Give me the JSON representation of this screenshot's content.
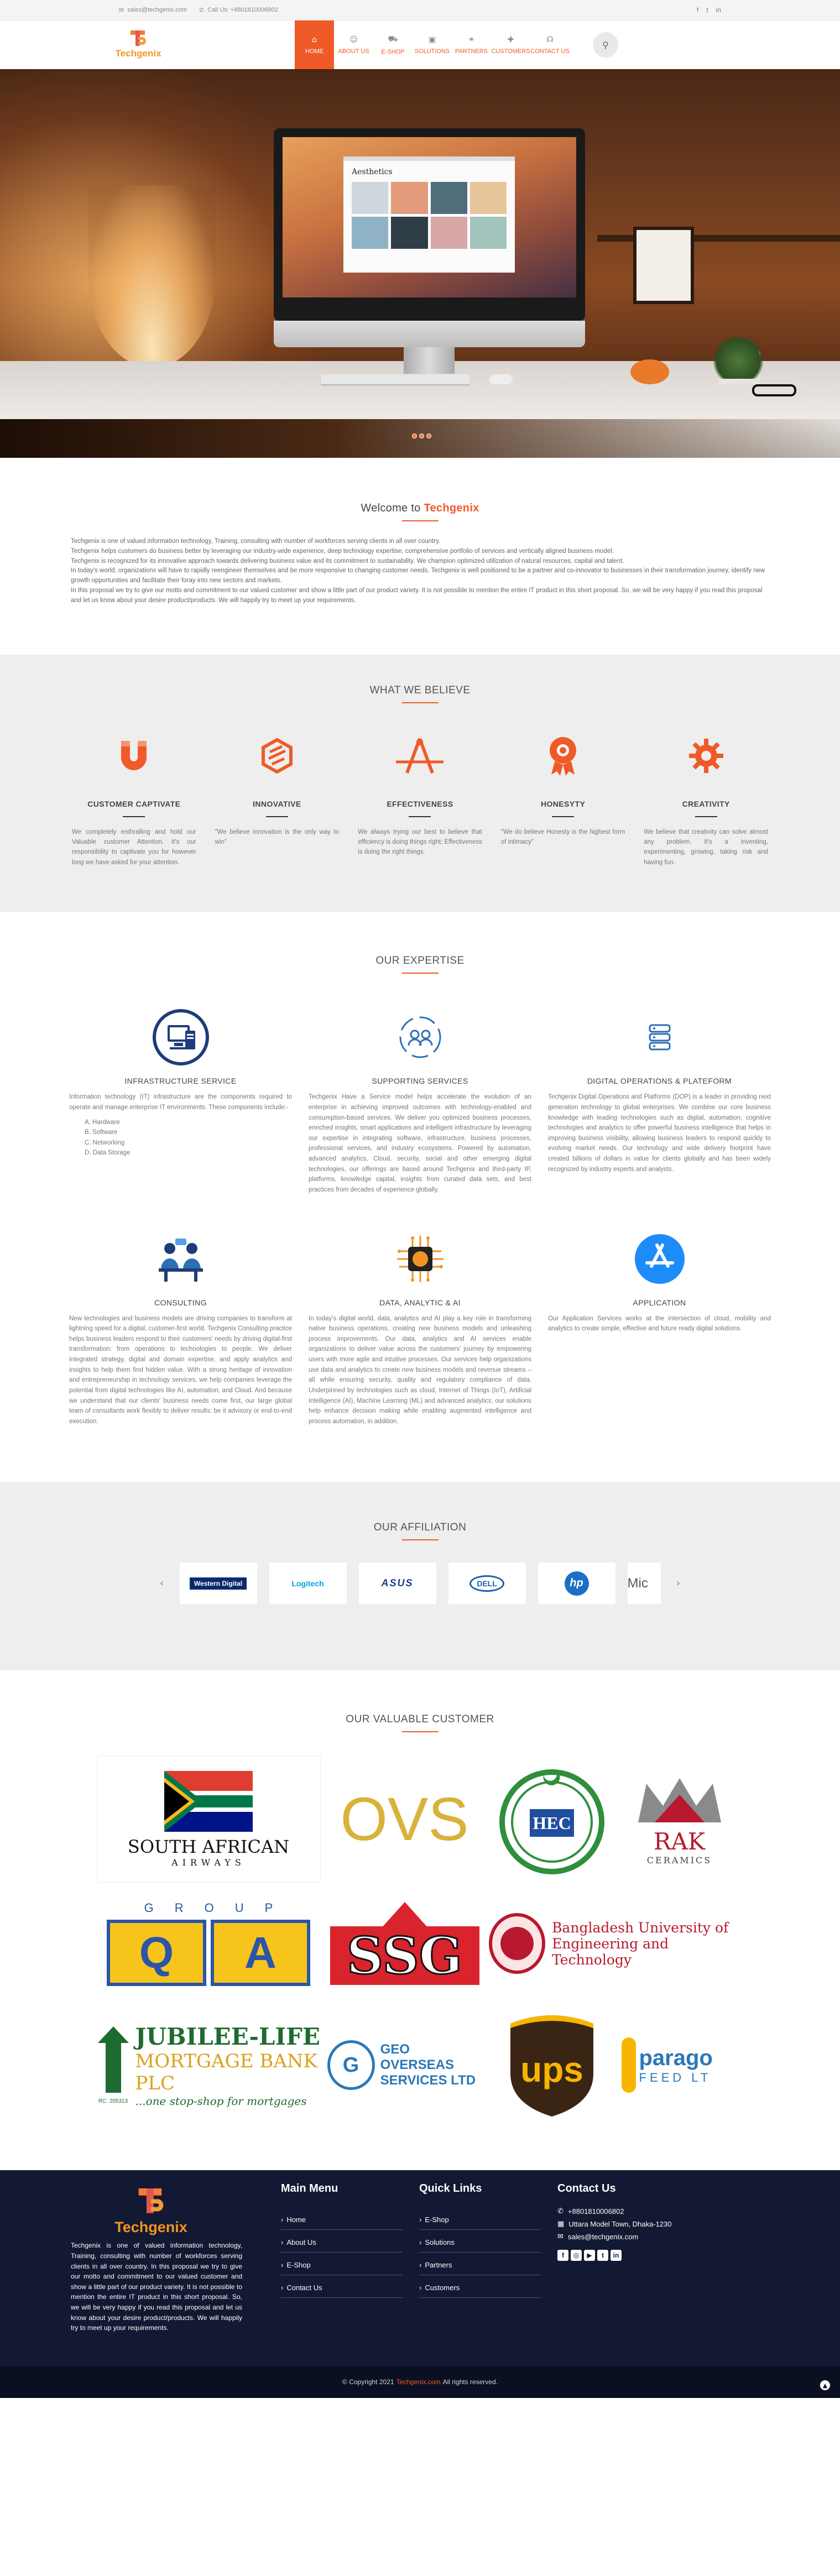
{
  "topbar": {
    "email": "sales@techgenix.com",
    "phone": "Call Us: +8801810006802",
    "social_icons": [
      "facebook-icon",
      "twitter-icon",
      "linkedin-icon"
    ]
  },
  "nav": {
    "logo_text": "Techgenix",
    "items": [
      {
        "label": "HOME",
        "icon": "home-icon",
        "active": true
      },
      {
        "label": "ABOUT US",
        "icon": "people-icon",
        "active": false
      },
      {
        "label": "E-SHOP",
        "icon": "cart-icon",
        "active": false
      },
      {
        "label": "SOLUTIONS",
        "icon": "briefcase-icon",
        "active": false
      },
      {
        "label": "PARTNERS",
        "icon": "handshake-icon",
        "active": false
      },
      {
        "label": "CUSTOMERS",
        "icon": "user-plus-icon",
        "active": false
      },
      {
        "label": "CONTACT US",
        "icon": "headset-icon",
        "active": false
      }
    ]
  },
  "hero": {
    "screen_title": "Aesthetics",
    "slides": 3
  },
  "welcome": {
    "title_prefix": "Welcome to ",
    "title_brand": "Techgenix",
    "paragraphs": [
      "Techgenix is one of valued information technology, Training, consulting with number of workforces serving clients in all over country.",
      "Techgenix helps customers do business better by leveraging our industry-wide experience, deep technology expertise, comprehensive portfolio of services and vertically aligned business model.",
      "Techgenix is recognized for its innovative approach towards delivering business value and its commitment to sustainability. We champion optimized utilization of natural resources, capital and talent.",
      "In today's world, organizations will have to rapidly reengineer themselves and be more responsive to changing customer needs. Techgenix is well positioned to be a partner and co-innovator to businesses in their transformation journey, identify new growth opportunities and facilitate their foray into new sectors and markets.",
      "In this proposal we try to give our motto and commitment to our valued customer and show a little part of our product variety. It is not possible to mention the entire IT product in this short proposal. So, we will be very happy if you read this proposal and let us know about your desire product/products. We will happily try to meet up your requirements."
    ]
  },
  "believe": {
    "title": "WHAT WE BELIEVE",
    "cards": [
      {
        "title": "CUSTOMER CAPTIVATE",
        "icon": "magnet-icon",
        "text": "We completely enthralling and hold our Valuable customer Attention. It's our responsibility to captivate you for however long we have asked for your attention."
      },
      {
        "title": "INNOVATIVE",
        "icon": "cube-icon",
        "text": "\"We believe innovation is the only way to win\""
      },
      {
        "title": "EFFECTIVENESS",
        "icon": "compass-icon",
        "text": "We always trying our best to believe that efficiency is doing things right; Effectiveness is doing the right things."
      },
      {
        "title": "HONESYTY",
        "icon": "award-icon",
        "text": "\"We do believe Honesty is the highest form of intimacy\""
      },
      {
        "title": "CREATIVITY",
        "icon": "gear-icon",
        "text": "We believe that creativity can solve almost any problem. It's a inventing, experimenting, growing, taking risk and having fun."
      }
    ]
  },
  "expertise": {
    "title": "OUR EXPERTISE",
    "cards": [
      {
        "title": "INFRASTRUCTURE SERVICE",
        "icon": "server-monitor-icon",
        "text": "Information technology (IT) infrastructure are the components required to operate and manage enterprise IT environments. These components include:-",
        "list": [
          "A. Hardware",
          "B. Software",
          "C. Networking",
          "D. Data Storage"
        ]
      },
      {
        "title": "SUPPORTING SERVICES",
        "icon": "support-team-icon",
        "text": "Techgenix Have a Service model helps accelerate the evolution of an enterprise in achieving improved outcomes with technology-enabled and consumption-based services. We deliver you optimized business processes, enriched insights, smart applications and intelligent infrastructure by leveraging our expertise in integrating software, infrastructure, business processes, professional services, and industry ecosystems. Powered by automation, advanced analytics, Cloud, security, social and other emerging digital technologies, our offerings are based around Techgenix and third-party IP, platforms, knowledge capital, insights from curated data sets, and best practices from decades of experience globally.",
        "list": []
      },
      {
        "title": "DIGITAL OPERATIONS & PLATEFORM",
        "icon": "database-icon",
        "text": "Techgenix Digital Operations and Platforms (DOP) is a leader in providing next generation technology to global enterprises. We combine our core business knowledge with leading technologies such as digital, automation, cognitive technologies and analytics to offer powerful business intelligence that helps in improving business visibility, allowing business leaders to respond quickly to evolving market needs. Our technology and wide delivery footprint have created billions of dollars in value for clients globally and has been widely recognized by industry experts and analysts.",
        "list": []
      },
      {
        "title": "CONSULTING",
        "icon": "consultant-icon",
        "text": "New technologies and business models are driving companies to transform at lightning speed for a digital, customer-first world. Techgenix Consulting practice helps business leaders respond to their customers' needs by driving digital-first transformation: from operations to technologies to people. We deliver integrated strategy, digital and domain expertise, and apply analytics and insights to help them find hidden value. With a strong heritage of innovation and entrepreneurship in technology services, we help companies leverage the potential from digital technologies like AI, automation, and Cloud. And because we understand that our clients' business needs come first, our large global team of consultants work flexibly to deliver results: be it advisory or end-to-end execution.",
        "list": []
      },
      {
        "title": "DATA, ANALYTIC & AI",
        "icon": "ai-chip-icon",
        "text": "In today's digital world, data, analytics and AI play a key role in transforming native business operations, creating new business models and unleashing process improvements. Our data, analytics and AI services enable organizations to deliver value across the customers' journey by empowering users with more agile and intuitive processes. Our services help organizations use data and analytics to create new business models and revenue streams – all while ensuring security, quality and regulatory compliance of data. Underpinned by technologies such as cloud, Internet of Things (IoT), Artificial Intelligence (AI), Machine Learning (ML) and advanced analytics, our solutions help enhance decision making while enabling augmented intelligence and process automation, in addition.",
        "list": []
      },
      {
        "title": "APPLICATION",
        "icon": "app-store-icon",
        "text": "Our Application Services works at the intersection of cloud, mobility and analytics to create simple, effective and future ready digital solutions.",
        "list": []
      }
    ]
  },
  "affiliation": {
    "title": "OUR AFFILIATION",
    "logos": [
      "Western Digital",
      "Logitech",
      "ASUS",
      "DELL",
      "hp",
      "Mic"
    ]
  },
  "customers": {
    "title": "OUR VALUABLE CUSTOMER",
    "logos": [
      {
        "name": "SOUTH AFRICAN",
        "sub": "AIRWAYS"
      },
      {
        "name": "OVS",
        "sub": ""
      },
      {
        "name": "HEC",
        "sub": ""
      },
      {
        "name": "RAK",
        "sub": "CERAMICS"
      },
      {
        "name": "GROUP",
        "sub": "QA"
      },
      {
        "name": "SSG",
        "sub": ""
      },
      {
        "name": "Bangladesh University of",
        "sub": "Engineering and Technology"
      },
      {
        "name": "JUBILEE-LIFE",
        "sub": "MORTGAGE BANK PLC",
        "tagline": "...one stop-shop for mortgages",
        "code": "RC: 205313"
      },
      {
        "name": "GEO OVERSEAS",
        "sub": "SERVICES LTD"
      },
      {
        "name": "ups",
        "sub": ""
      },
      {
        "name": "parago",
        "sub": "FEED LT"
      }
    ]
  },
  "footer": {
    "logo_text": "Techgenix",
    "about": "Techgenix is one of valued information technology, Training, consulting with number of workforces serving clients in all over country. In this proposal we try to give our motto and commitment to our valued customer and show a little part of our product variety. It is not possible to mention the entire IT product in this short proposal. So, we will be very happy if you read this proposal and let us know about your desire product/products. We will happily try to meet up your requirements.",
    "main_menu_title": "Main Menu",
    "main_menu": [
      "Home",
      "About Us",
      "E-Shop",
      "Contact Us"
    ],
    "quick_links_title": "Quick Links",
    "quick_links": [
      "E-Shop",
      "Solutions",
      "Partners",
      "Customers"
    ],
    "contact_title": "Contact Us",
    "phone": "+8801810006802",
    "address": "Uttara Model Town, Dhaka-1230",
    "email": "sales@techgenix.com",
    "social_icons": [
      "facebook-icon",
      "instagram-icon",
      "youtube-icon",
      "twitter-icon",
      "linkedin-icon"
    ],
    "copyright_prefix": "© Copyright 2021",
    "copyright_brand": "Techgenix.com",
    "copyright_suffix": "All rights reserved."
  }
}
